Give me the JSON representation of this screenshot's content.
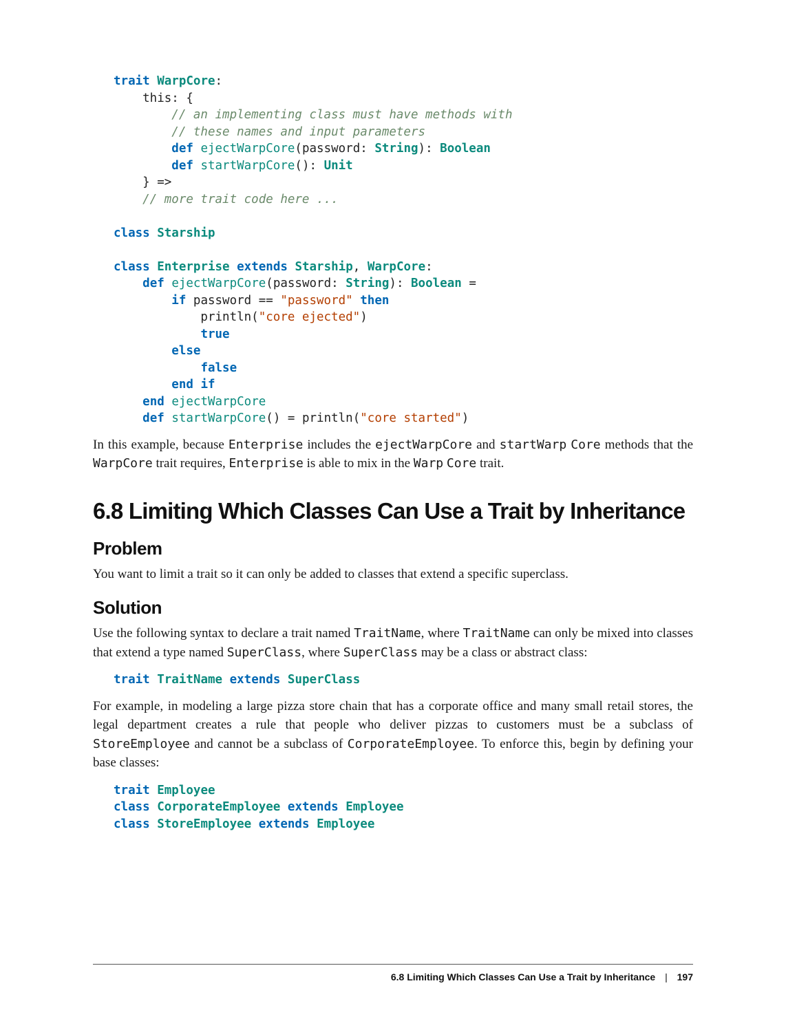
{
  "code1": {
    "l1": {
      "kw": "trait",
      "tp": "WarpCore",
      "colon": ":"
    },
    "l2": "    this: {",
    "l3_cm": "        // an implementing class must have methods with",
    "l4_cm": "        // these names and input parameters",
    "l5": {
      "pad": "        ",
      "kw": "def",
      "fn": "ejectWarpCore",
      "sig1": "(password: ",
      "tp1": "String",
      "sig2": "): ",
      "tp2": "Boolean"
    },
    "l6": {
      "pad": "        ",
      "kw": "def",
      "fn": "startWarpCore",
      "sig1": "(): ",
      "tp1": "Unit"
    },
    "l7": "    } =>",
    "l8_cm": "    // more trait code here ...",
    "blank1": "",
    "l9": {
      "kw": "class",
      "tp": "Starship"
    },
    "blank2": "",
    "l10": {
      "kw1": "class",
      "tp1": "Enterprise",
      "kw2": "extends",
      "tp2": "Starship",
      "comma": ", ",
      "tp3": "WarpCore",
      "colon": ":"
    },
    "l11": {
      "pad": "    ",
      "kw": "def",
      "fn": "ejectWarpCore",
      "sig1": "(password: ",
      "tp1": "String",
      "sig2": "): ",
      "tp2": "Boolean",
      "eq": " ="
    },
    "l12": {
      "pad": "        ",
      "kw1": "if",
      "mid": " password == ",
      "st": "\"password\"",
      "sp": " ",
      "kw2": "then"
    },
    "l13": {
      "pad": "            println(",
      "st": "\"core ejected\"",
      "end": ")"
    },
    "l14": {
      "pad": "            ",
      "kw": "true"
    },
    "l15": {
      "pad": "        ",
      "kw": "else"
    },
    "l16": {
      "pad": "            ",
      "kw": "false"
    },
    "l17": {
      "pad": "        ",
      "kw": "end if"
    },
    "l18": {
      "pad": "    ",
      "kw": "end",
      "sp": " ",
      "fn": "ejectWarpCore"
    },
    "l19": {
      "pad": "    ",
      "kw": "def",
      "fn": "startWarpCore",
      "sig": "() = println(",
      "st": "\"core started\"",
      "end": ")"
    }
  },
  "para1": {
    "a": "In this example, because ",
    "b": "Enterprise",
    "c": " includes the ",
    "d": "ejectWarpCore",
    "e": " and ",
    "f": "startWarp",
    "g": "Core",
    "h": " methods that the ",
    "i": "WarpCore",
    "j": " trait requires, ",
    "k": "Enterprise",
    "l": " is able to mix in the ",
    "m": "Warp",
    "n": "Core",
    "o": " trait."
  },
  "section_title": "6.8 Limiting Which Classes Can Use a Trait by Inheritance",
  "problem_h": "Problem",
  "problem_p": "You want to limit a trait so it can only be added to classes that extend a specific superclass.",
  "solution_h": "Solution",
  "solution_p1": {
    "a": "Use the following syntax to declare a trait named ",
    "b": "TraitName",
    "c": ", where ",
    "d": "TraitName",
    "e": " can only be mixed into classes that extend a type named ",
    "f": "SuperClass",
    "g": ", where ",
    "h": "SuperClass",
    "i": " may be a class or abstract class:"
  },
  "code2": {
    "kw1": "trait",
    "tp1": "TraitName",
    "kw2": "extends",
    "tp2": "SuperClass"
  },
  "solution_p2": {
    "a": "For example, in modeling a large pizza store chain that has a corporate office and many small retail stores, the legal department creates a rule that people who deliver pizzas to customers must be a subclass of ",
    "b": "StoreEmployee",
    "c": " and cannot be a subclass of ",
    "d": "CorporateEmployee",
    "e": ". To enforce this, begin by defining your base classes:"
  },
  "code3": {
    "l1": {
      "kw": "trait",
      "tp": "Employee"
    },
    "l2": {
      "kw1": "class",
      "tp1": "CorporateEmployee",
      "kw2": "extends",
      "tp2": "Employee"
    },
    "l3": {
      "kw1": "class",
      "tp1": "StoreEmployee",
      "kw2": "extends",
      "tp2": "Employee"
    }
  },
  "footer": {
    "title": "6.8 Limiting Which Classes Can Use a Trait by Inheritance",
    "sep": "|",
    "page": "197"
  }
}
